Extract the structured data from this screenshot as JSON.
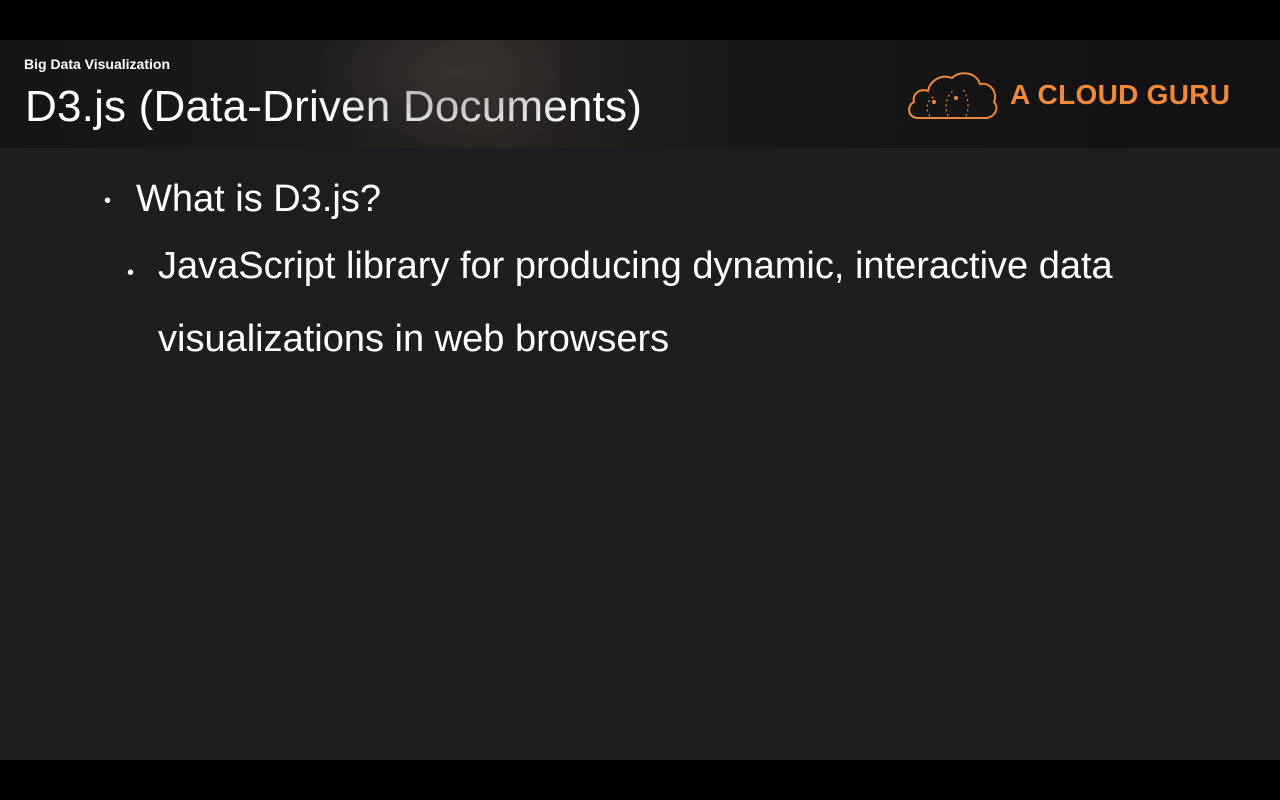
{
  "slide": {
    "course_label": "Big Data Visualization",
    "title": "D3.js (Data-Driven Documents)"
  },
  "logo": {
    "text": "A CLOUD GURU",
    "icon": "cloud-logo-icon",
    "color": "#f0883a"
  },
  "bullets": [
    {
      "level": 1,
      "text": "What is D3.js?"
    },
    {
      "level": 2,
      "text": "JavaScript library for producing dynamic, interactive data visualizations in web browsers"
    }
  ],
  "colors": {
    "background": "#1e1d20",
    "text": "#ffffff",
    "accent": "#f0883a"
  }
}
